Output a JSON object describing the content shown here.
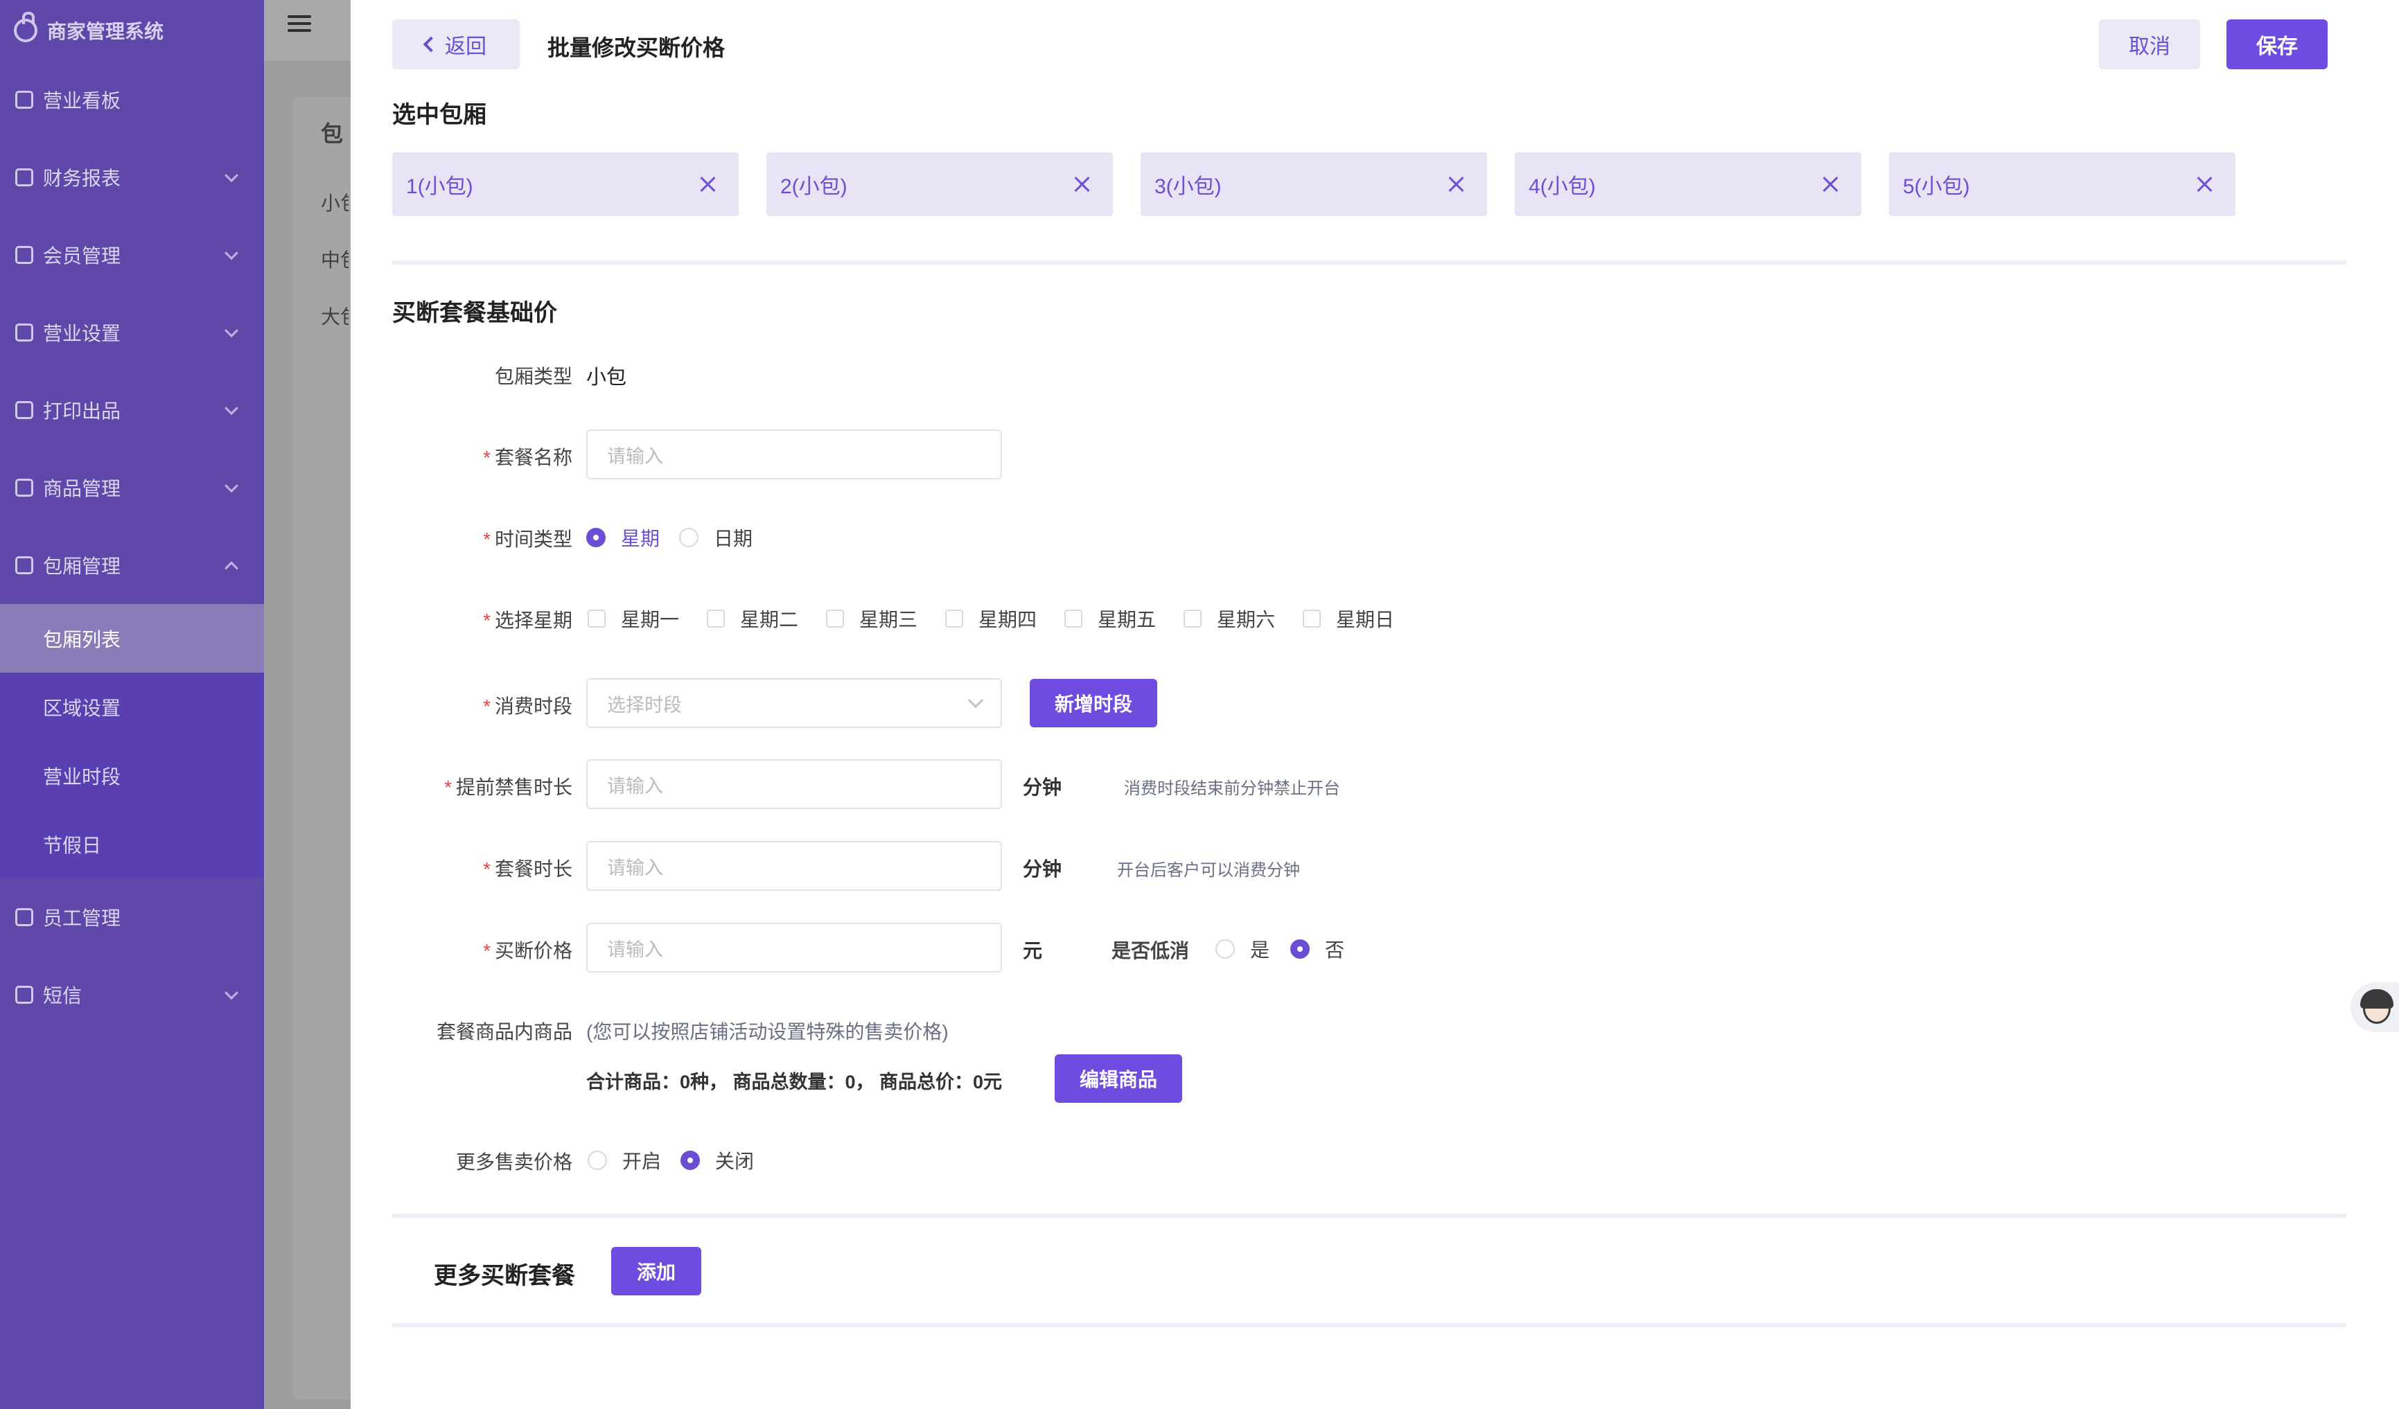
{
  "app": {
    "brand": "商家管理系统"
  },
  "sidebar": {
    "items": [
      {
        "label": "营业看板"
      },
      {
        "label": "财务报表"
      },
      {
        "label": "会员管理"
      },
      {
        "label": "营业设置"
      },
      {
        "label": "打印出品"
      },
      {
        "label": "商品管理"
      },
      {
        "label": "包厢管理"
      },
      {
        "label": "员工管理"
      },
      {
        "label": "短信"
      }
    ],
    "submenu": [
      "包厢列表",
      "区域设置",
      "营业时段",
      "节假日"
    ]
  },
  "underlay": {
    "title": "包",
    "rows": [
      "小包",
      "中包",
      "大包"
    ]
  },
  "header": {
    "back": "返回",
    "title": "批量修改买断价格",
    "cancel": "取消",
    "save": "保存"
  },
  "selected": {
    "title": "选中包厢",
    "tags": [
      "1(小包)",
      "2(小包)",
      "3(小包)",
      "4(小包)",
      "5(小包)"
    ]
  },
  "form": {
    "section_title": "买断套餐基础价",
    "room_type_label": "包厢类型",
    "room_type_value": "小包",
    "name_label": "套餐名称",
    "name_placeholder": "请输入",
    "time_type_label": "时间类型",
    "time_type_week": "星期",
    "time_type_date": "日期",
    "weekday_label": "选择星期",
    "weekdays": [
      "星期一",
      "星期二",
      "星期三",
      "星期四",
      "星期五",
      "星期六",
      "星期日"
    ],
    "period_label": "消费时段",
    "period_placeholder": "选择时段",
    "add_period": "新增时段",
    "presale_label": "提前禁售时长",
    "presale_placeholder": "请输入",
    "presale_unit": "分钟",
    "presale_hint": "消费时段结束前分钟禁止开台",
    "duration_label": "套餐时长",
    "duration_placeholder": "请输入",
    "duration_unit": "分钟",
    "duration_hint": "开台后客户可以消费分钟",
    "price_label": "买断价格",
    "price_placeholder": "请输入",
    "price_unit": "元",
    "min_spend_label": "是否低消",
    "yes": "是",
    "no": "否",
    "goods_label": "套餐商品内商品",
    "goods_hint": "(您可以按照店铺活动设置特殊的售卖价格)",
    "goods_summary": "合计商品：0种，  商品总数量：0，  商品总价：0元",
    "edit_goods": "编辑商品",
    "more_price_label": "更多售卖价格",
    "more_price_on": "开启",
    "more_price_off": "关闭"
  },
  "more": {
    "title": "更多买断套餐",
    "add": "添加"
  },
  "colors": {
    "accent": "#6e4ce0",
    "sidebar": "#5f48a9",
    "tag_bg": "#e8e4f5",
    "required": "#e04545"
  }
}
